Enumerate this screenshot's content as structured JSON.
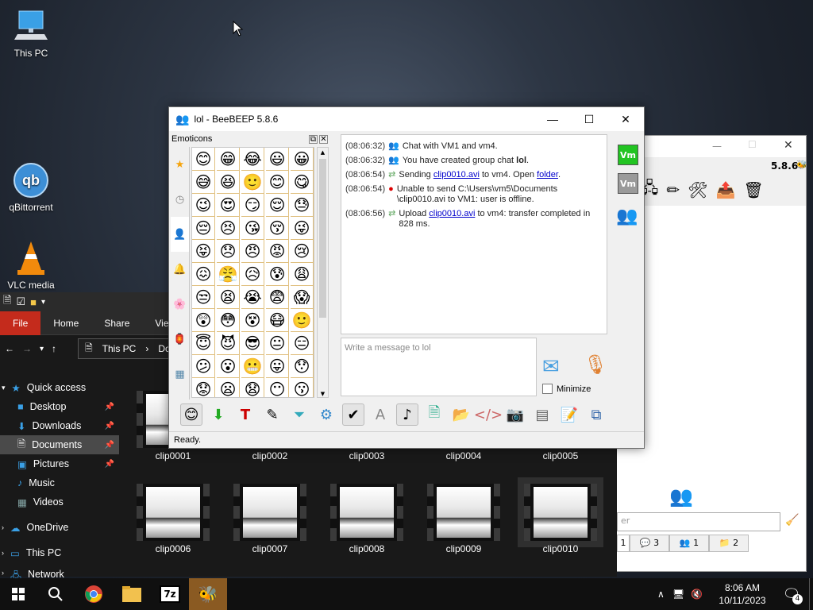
{
  "desktop": {
    "icons": [
      {
        "label": "This PC"
      },
      {
        "label": "qBittorrent"
      },
      {
        "label": "VLC media"
      }
    ]
  },
  "explorer": {
    "ribbon_tabs": [
      "File",
      "Home",
      "Share",
      "View"
    ],
    "address": {
      "root": "This PC",
      "crumb": "Do"
    },
    "nav": {
      "quick_access": "Quick access",
      "items": [
        {
          "label": "Desktop"
        },
        {
          "label": "Downloads"
        },
        {
          "label": "Documents"
        },
        {
          "label": "Pictures"
        },
        {
          "label": "Music"
        },
        {
          "label": "Videos"
        }
      ],
      "onedrive": "OneDrive",
      "thispc": "This PC",
      "network": "Network"
    },
    "files": [
      "clip0001",
      "clip0002",
      "clip0003",
      "clip0004",
      "clip0005",
      "clip0006",
      "clip0007",
      "clip0008",
      "clip0009",
      "clip0010"
    ]
  },
  "bg_window": {
    "version": "5.8.6",
    "search_placeholder": "er",
    "tabs": [
      {
        "count": "1"
      },
      {
        "count": "3"
      },
      {
        "count": "1"
      },
      {
        "count": "2"
      }
    ]
  },
  "window": {
    "title": "lol - BeeBEEP 5.8.6",
    "emoticons_title": "Emoticons",
    "chat": [
      {
        "time": "(08:06:32)",
        "text": "Chat with VM1 and vm4."
      },
      {
        "time": "(08:06:32)",
        "text_before": "You have created group chat ",
        "bold": "lol",
        "text_after": "."
      },
      {
        "time": "(08:06:54)",
        "text_before": "Sending ",
        "link": "clip0010.avi",
        "text_mid": " to vm4. Open ",
        "link2": "folder",
        "text_after": "."
      },
      {
        "time": "(08:06:54)",
        "text": "Unable to send C:\\Users\\vm5\\Documents \\clip0010.avi to VM1: user is offline."
      },
      {
        "time": "(08:06:56)",
        "text_before": "Upload ",
        "link": "clip0010.avi",
        "text_after": " to vm4: transfer completed in 828 ms."
      }
    ],
    "message_placeholder": "Write a message to lol",
    "minimize_label": "Minimize",
    "status": "Ready.",
    "users": [
      {
        "label": "Vm",
        "color": "#22c422"
      },
      {
        "label": "Vm",
        "color": "#9a9a9a"
      }
    ]
  },
  "taskbar": {
    "time": "8:06 AM",
    "date": "10/11/2023",
    "notifications": "4",
    "app_7z": "7z"
  },
  "emoticons": [
    "😊",
    "😁",
    "😂",
    "😃",
    "😀",
    "😅",
    "😆",
    "🙂",
    "😊",
    "😋",
    "😉",
    "😍",
    "😏",
    "😌",
    "😓",
    "😔",
    "😣",
    "😘",
    "😚",
    "😜",
    "😝",
    "😞",
    "😠",
    "😡",
    "😢",
    "😖",
    "😤",
    "😥",
    "😰",
    "😩",
    "😒",
    "😫",
    "😭",
    "😨",
    "😱",
    "😲",
    "😳",
    "😵",
    "😷",
    "🙂",
    "😇",
    "😈",
    "😎",
    "😐",
    "😑",
    "😕",
    "😮",
    "😬",
    "😛",
    "😯",
    "😟",
    "😦",
    "😧",
    "😶",
    "😗"
  ]
}
